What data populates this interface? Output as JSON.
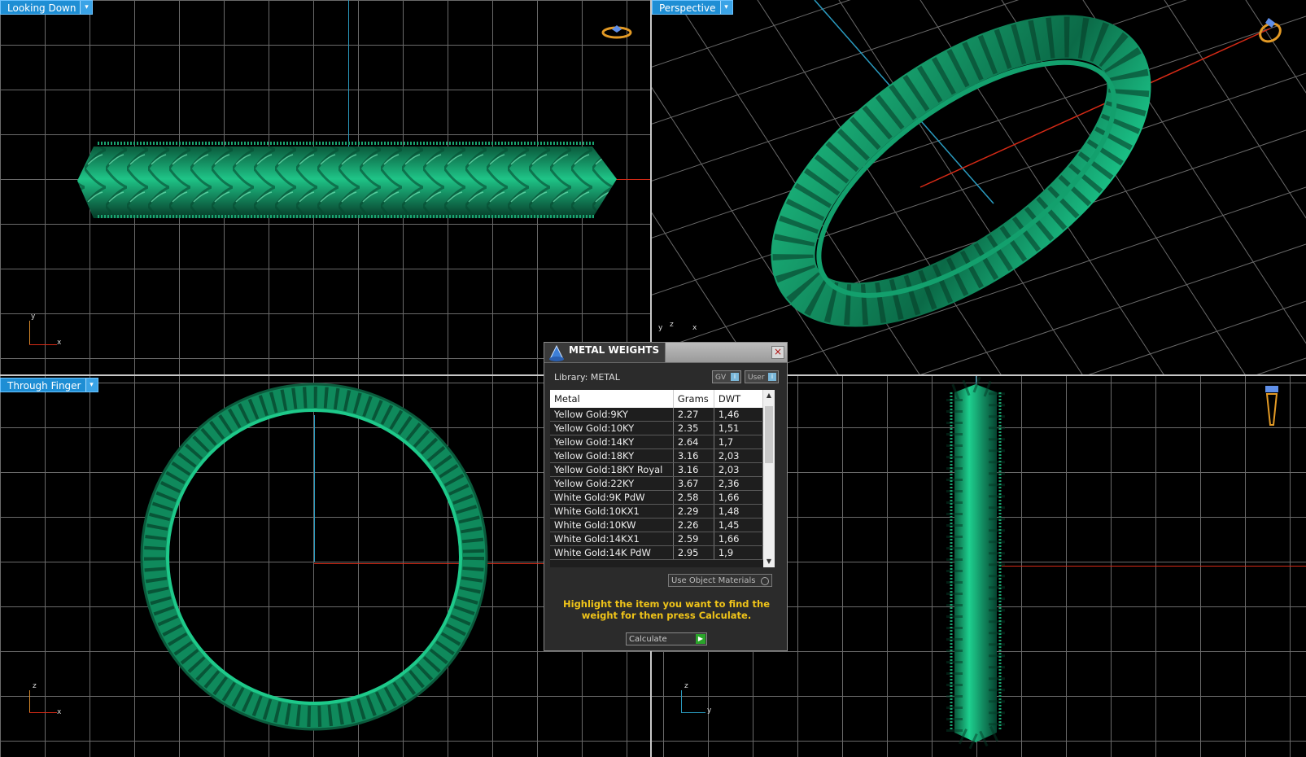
{
  "viewports": {
    "top_left": {
      "label": "Looking Down"
    },
    "top_right": {
      "label": "Perspective"
    },
    "bottom_left": {
      "label": "Through Finger"
    },
    "bottom_right": {
      "label": ""
    }
  },
  "axis_labels": {
    "tl": {
      "v": "y",
      "h": "x"
    },
    "tr": {
      "v": "y",
      "m": "z",
      "h": "x"
    },
    "bl": {
      "v": "z",
      "h": "x"
    },
    "br": {
      "v": "z",
      "h": "y"
    }
  },
  "colors": {
    "ring": "#10a06a",
    "axis_x": "#d52a16",
    "axis_y": "#2a9bc0",
    "accent": "#1e8ed4"
  },
  "dialog": {
    "title": "METAL WEIGHTS",
    "library_label": "Library: METAL",
    "btn_gv": "GV",
    "btn_user": "User",
    "columns": [
      "Metal",
      "Grams",
      "DWT"
    ],
    "rows": [
      [
        "Yellow Gold:9KY",
        "2.27",
        "1,46"
      ],
      [
        "Yellow Gold:10KY",
        "2.35",
        "1,51"
      ],
      [
        "Yellow Gold:14KY",
        "2.64",
        "1,7"
      ],
      [
        "Yellow Gold:18KY",
        "3.16",
        "2,03"
      ],
      [
        "Yellow Gold:18KY Royal",
        "3.16",
        "2,03"
      ],
      [
        "Yellow Gold:22KY",
        "3.67",
        "2,36"
      ],
      [
        "White Gold:9K PdW",
        "2.58",
        "1,66"
      ],
      [
        "White Gold:10KX1",
        "2.29",
        "1,48"
      ],
      [
        "White Gold:10KW",
        "2.26",
        "1,45"
      ],
      [
        "White Gold:14KX1",
        "2.59",
        "1,66"
      ],
      [
        "White Gold:14K PdW",
        "2.95",
        "1,9"
      ]
    ],
    "use_object_materials": "Use Object Materials",
    "hint": "Highlight the item you want to find the weight for then press Calculate.",
    "calculate": "Calculate"
  }
}
